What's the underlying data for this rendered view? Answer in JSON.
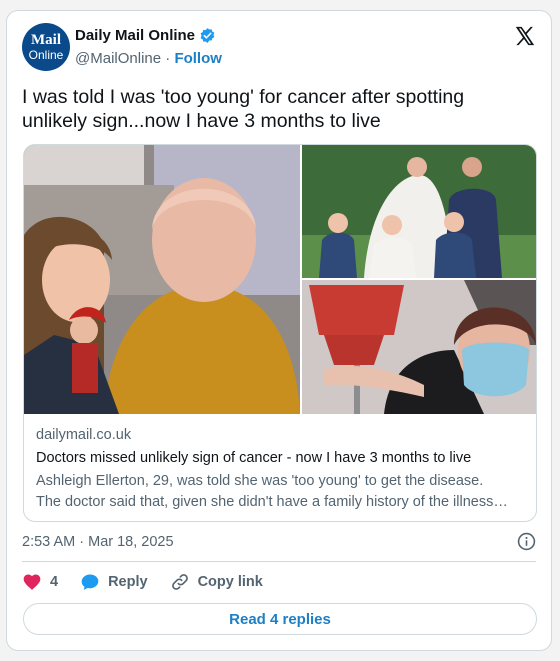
{
  "account": {
    "logo_line1": "Mail",
    "logo_line2": "Online",
    "name": "Daily Mail Online",
    "handle": "@MailOnline",
    "separator": "·",
    "follow": "Follow"
  },
  "tweet": {
    "text": "I was told I was 'too young' for cancer after spotting unlikely sign...now I have 3 months to live"
  },
  "link_card": {
    "domain": "dailymail.co.uk",
    "title": "Doctors missed unlikely sign of cancer - now I have 3 months to live",
    "description_line1": "Ashleigh Ellerton, 29, was told she was 'too young' to get the disease.",
    "description_line2": "The doctor said that, given she didn't have a family history of the illness…"
  },
  "meta": {
    "time": "2:53 AM",
    "separator": "·",
    "date": "Mar 18, 2025"
  },
  "actions": {
    "likes": "4",
    "reply": "Reply",
    "copy_link": "Copy link"
  },
  "read_replies": "Read 4 replies",
  "colors": {
    "accent": "#1d7fc4",
    "heart": "#e0245e",
    "verified": "#1d9bf0"
  }
}
